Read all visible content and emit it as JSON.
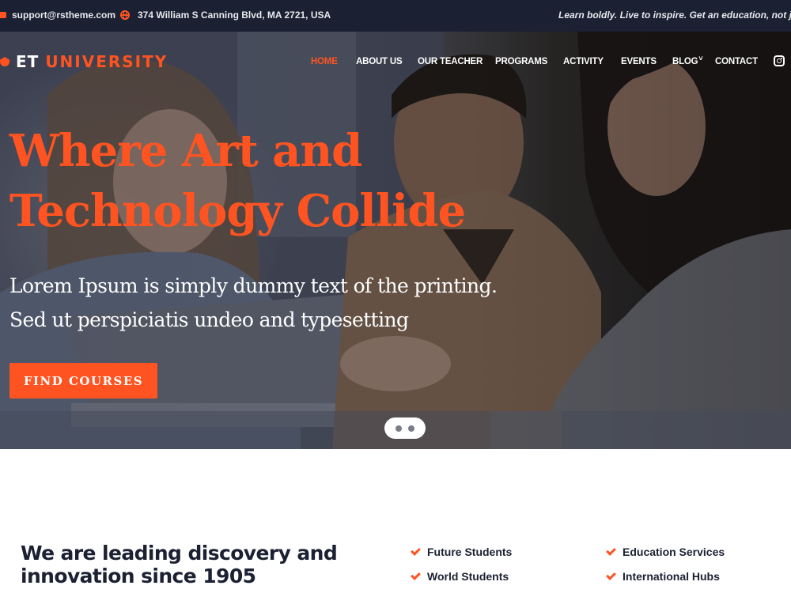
{
  "topbar": {
    "email": "support@rstheme.com",
    "address": "374 William S Canning Blvd, MA 2721, USA",
    "tagline": "Learn boldly. Live to inspire. Get an education, not just a d",
    "email_icon": "envelope-icon",
    "address_icon": "globe-icon"
  },
  "header": {
    "logo_prefix": "ET",
    "logo_name": "UNIVERSITY",
    "logo_icon": "graduation-cap-icon",
    "nav": [
      {
        "label": "HOME",
        "active": true
      },
      {
        "label": "ABOUT US",
        "active": false
      },
      {
        "label": "OUR TEACHER",
        "active": false
      },
      {
        "label": "PROGRAMS",
        "active": false
      },
      {
        "label": "ACTIVITY",
        "active": false
      },
      {
        "label": "EVENTS",
        "active": false
      },
      {
        "label": "BLOG",
        "active": false,
        "has_dropdown": true
      },
      {
        "label": "CONTACT",
        "active": false
      }
    ],
    "dropdown_glyph": "˅",
    "social_icon": "instagram-icon"
  },
  "hero": {
    "title_line1": "Where Art and",
    "title_line2": "Technology Collide",
    "subtitle_line1": "Lorem Ipsum is simply dummy text of the printing.",
    "subtitle_line2": "Sed ut perspiciatis undeo and typesetting",
    "cta_label": "FIND COURSES",
    "slide_count": 2
  },
  "about": {
    "title_line1": "We are leading discovery and",
    "title_line2": "innovation since 1905",
    "features": [
      "Future Students",
      "Education Services",
      "World Students",
      "International Hubs"
    ]
  },
  "colors": {
    "accent": "#ff5421",
    "dark": "#1b2032",
    "white": "#ffffff"
  }
}
